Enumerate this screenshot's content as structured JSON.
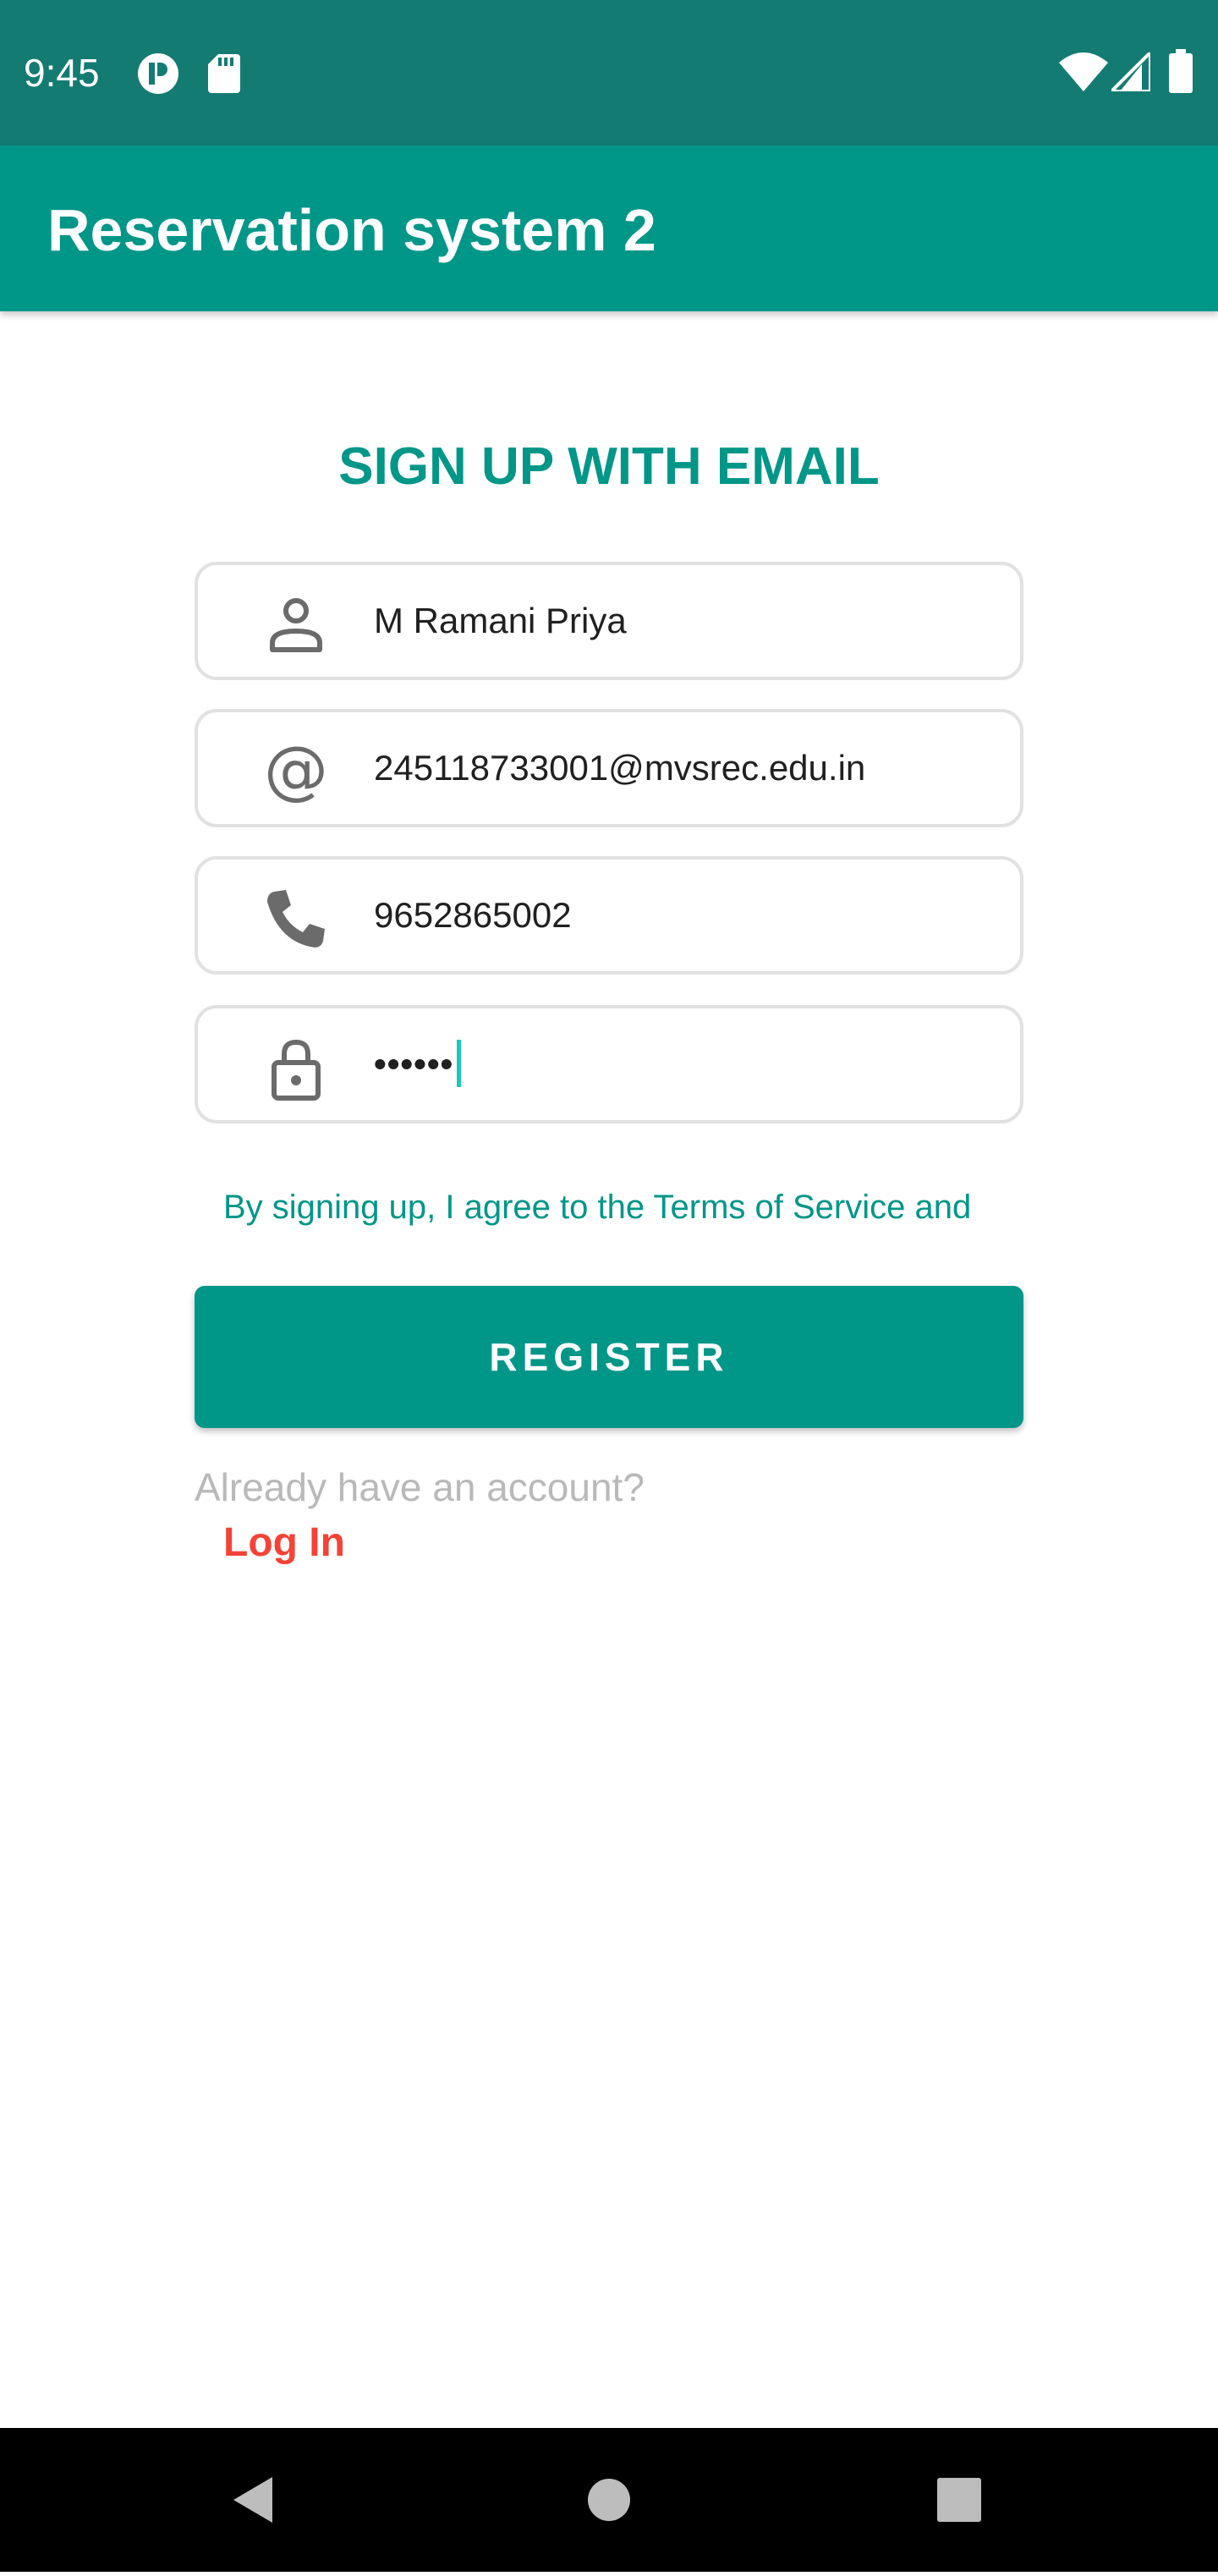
{
  "status_bar": {
    "time": "9:45",
    "left_icons": [
      "p-circle-icon",
      "sd-card-icon"
    ],
    "right_icons": [
      "wifi-icon",
      "cell-signal-icon",
      "battery-icon"
    ]
  },
  "app_bar": {
    "title": "Reservation system 2"
  },
  "form": {
    "heading": "SIGN UP WITH EMAIL",
    "fields": [
      {
        "icon": "person-icon",
        "value": "M Ramani Priya"
      },
      {
        "icon": "at-sign-icon",
        "value": "245118733001@mvsrec.edu.in"
      },
      {
        "icon": "phone-icon",
        "value": "9652865002"
      },
      {
        "icon": "lock-icon",
        "value": "••••••"
      }
    ],
    "terms_text": "By signing up, I agree to the Terms of Service and",
    "register_label": "REGISTER",
    "already_text": "Already have an account?",
    "login_label": "Log In"
  },
  "nav_bar": {
    "buttons": [
      "back-icon",
      "home-icon",
      "recents-icon"
    ]
  },
  "colors": {
    "status_bar": "#147b73",
    "primary": "#009688",
    "login_link": "#f44336",
    "cursor": "#1ec8b8"
  }
}
